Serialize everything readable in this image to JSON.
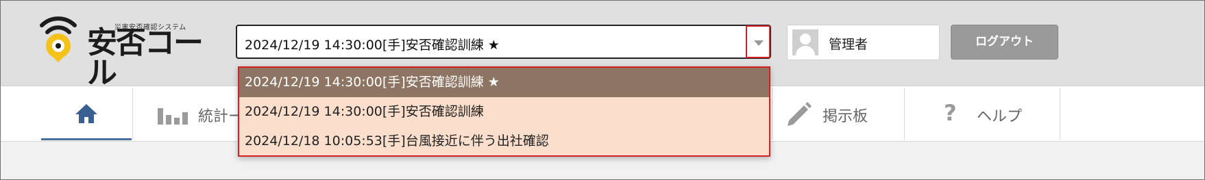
{
  "brand": {
    "subtitle": "災害安否確認システム",
    "name": "安否コール"
  },
  "event_select": {
    "value": "2024/12/19 14:30:00[手]安否確認訓練 ★",
    "options": [
      "2024/12/19 14:30:00[手]安否確認訓練 ★",
      "2024/12/19 14:30:00[手]安否確認訓練",
      "2024/12/18 10:05:53[手]台風接近に伴う出社確認"
    ],
    "selected_index": 0
  },
  "user": {
    "name": "管理者"
  },
  "logout_label": "ログアウト",
  "nav": {
    "stats_label": "統計ー",
    "board_label": "掲示板",
    "help_label": "ヘルプ"
  },
  "colors": {
    "highlight_border": "#d42020",
    "dropdown_bg": "#fbdecb",
    "selected_option_bg": "#8e7563",
    "logo_yellow": "#f4c21b",
    "nav_active": "#4a6fa0"
  }
}
